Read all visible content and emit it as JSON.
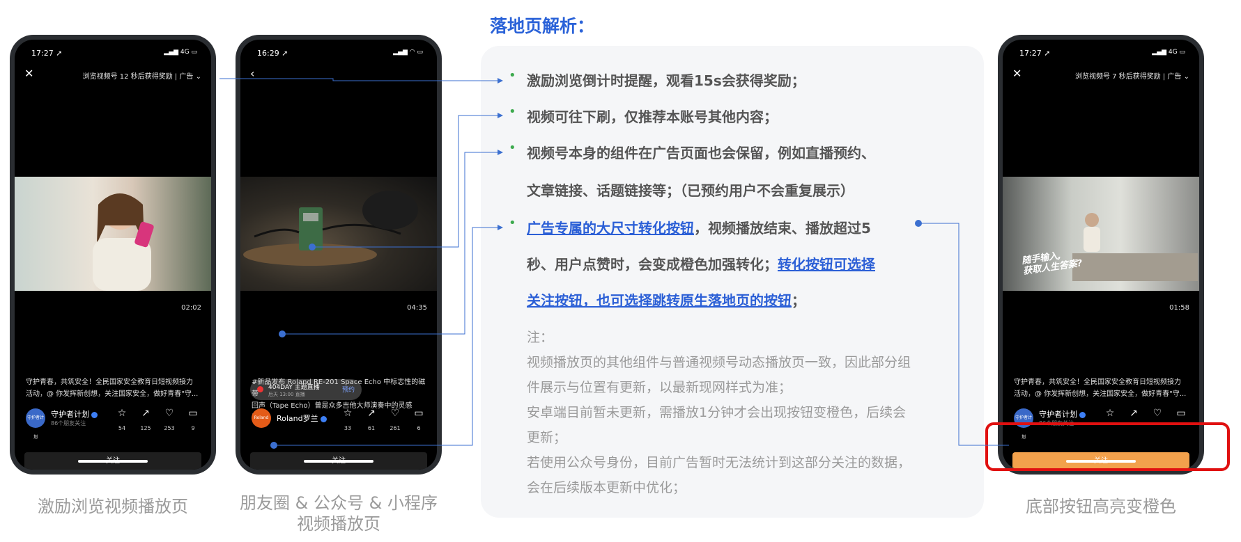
{
  "heading": "落地页解析：",
  "phones": [
    {
      "time": "17:27 ➚",
      "signal": "▂▄▆ 4G ▭",
      "reward_text": "浏览视频号 12 秒后获得奖励  |  广告 ⌄",
      "duration": "02:02",
      "caption_line1": "守护青春，共筑安全！全民国家安全教育日短视频接力",
      "caption_line2": "活动，@ 你发挥新创想，关注国家安全，做好青春\"守...",
      "author": "守护者计划",
      "author_sub": "86个朋友关注",
      "avatar_text": "守护者计划",
      "counts": [
        "54",
        "125",
        "253",
        "9"
      ],
      "follow": "关注",
      "label": "激励浏览视频播放页"
    },
    {
      "time": "16:29 ➚",
      "signal": "▂▄▆ ◠ ▭",
      "duration": "04:35",
      "live_title": "404DAY 主题直播",
      "live_time": "后天 13:00 直播",
      "live_btn": "预约",
      "caption_line1": "#新品发布 Roland RE-201 Space Echo 中标志性的磁带",
      "caption_line2": "回声（Tape Echo）曾是众多吉他大师演奏中的灵感源...",
      "author": "Roland罗兰",
      "avatar_text": "Roland",
      "counts": [
        "33",
        "61",
        "261",
        "6"
      ],
      "follow": "关注",
      "label_line1": "朋友圈 & 公众号 & 小程序",
      "label_line2": "视频播放页"
    },
    {
      "time": "17:27 ➚",
      "signal": "▂▄▆ 4G ▭",
      "reward_text": "浏览视频号 7 秒后获得奖励  |  广告 ⌄",
      "duration": "01:58",
      "overlay_line1": "随手输入,",
      "overlay_line2": "获取人生答案?",
      "caption_line1": "守护青春，共筑安全！全民国家安全教育日短视频接力",
      "caption_line2": "活动，@ 你发挥新创想，关注国家安全，做好青春\"守...",
      "author": "守护者计划",
      "author_sub": "86个朋友关注",
      "avatar_text": "守护者计划",
      "follow": "关注",
      "label": "底部按钮高亮变橙色"
    }
  ],
  "points": [
    {
      "text": "激励浏览倒计时提醒，观看15s会获得奖励；"
    },
    {
      "text": "视频可往下刷，仅推荐本账号其他内容；"
    },
    {
      "line1": "视频号本身的组件在广告页面也会保留，例如直播预约、",
      "line2": "文章链接、话题链接等；（已预约用户不会重复展示）"
    },
    {
      "hl1": "广告专属的大尺寸转化按钮",
      "t1": "，视频播放结束、播放超过5",
      "t2": "秒、用户点赞时，会变成橙色加强转化；",
      "hl2": "转化按钮可选择",
      "hl3": "关注按钮，也可选择跳转原生落地页的按钮",
      "t3": "；"
    }
  ],
  "notes": [
    "注：",
    "视频播放页的其他组件与普通视频号动态播放页一致，因此部分组",
    "件展示与位置有更新，以最新现网样式为准；",
    "安卓端目前暂未更新，需播放1分钟才会出现按钮变橙色，后续会",
    "更新；",
    "若使用公众号身份，目前广告暂时无法统计到这部分关注的数据，",
    "会在后续版本更新中优化；"
  ],
  "colors": {
    "accent_blue": "#2a62d8",
    "highlight_orange": "#f2a14c",
    "alert_red": "#e01010",
    "bullet_green": "#3daa4e"
  }
}
